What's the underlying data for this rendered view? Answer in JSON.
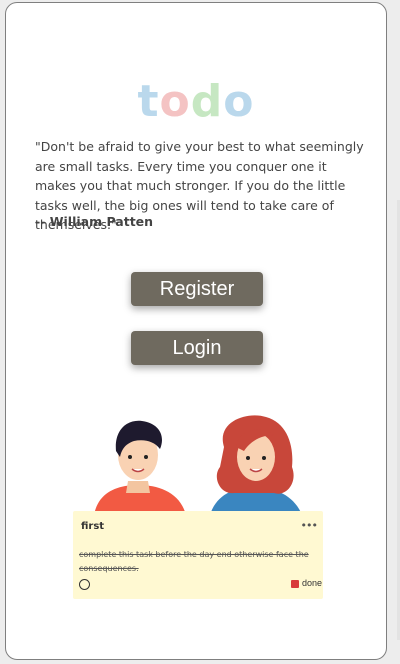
{
  "logo": {
    "letters": [
      "t",
      "o",
      "d",
      "o"
    ],
    "colors": [
      "#a9cfe8",
      "#f2b5b5",
      "#b9e2b3",
      "#a9cfe8"
    ]
  },
  "quote": {
    "text": "\"Don't be afraid to give your best to what seemingly are small tasks. Every time you conquer one it makes you that much stronger. If you do the little tasks well, the big ones will tend to take care of themselves.\"",
    "author": "-- William Patten"
  },
  "buttons": {
    "register": "Register",
    "login": "Login"
  },
  "sample_note": {
    "title": "first",
    "more_icon": "ellipsis-icon",
    "more_label": "•••",
    "text": "complete this task before the day end otherwise face the consequences.",
    "done_label": "done",
    "done_checked": true
  },
  "colors": {
    "button_bg": "#6f6a5f",
    "note_bg": "#fff9d2",
    "check": "#d83b3b"
  }
}
